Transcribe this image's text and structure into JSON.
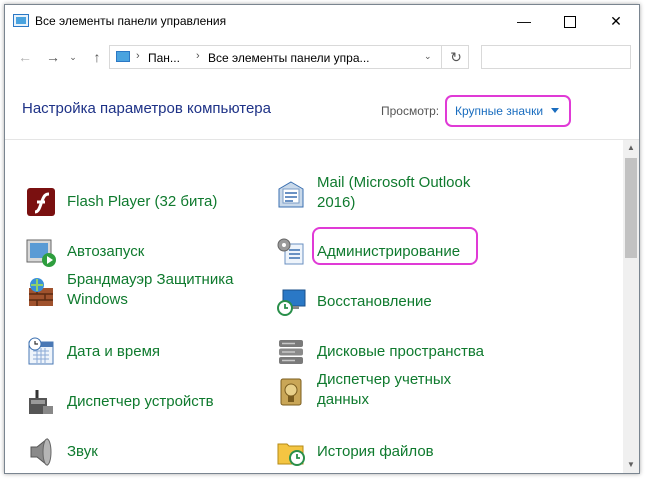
{
  "window": {
    "title": "Все элементы панели управления",
    "icons": [
      "control-panel-icon",
      "minimize-icon",
      "maximize-icon",
      "close-icon"
    ]
  },
  "address": {
    "back": "←",
    "forward": "→",
    "recent": "⌄",
    "up": "↑",
    "sep": "›",
    "crumbs": [
      "Пан...",
      "Все элементы панели упра..."
    ],
    "dropdown": "⌄",
    "refresh": "↻",
    "search_placeholder": ""
  },
  "header": {
    "title": "Настройка параметров компьютера",
    "view_label": "Просмотр:",
    "view_value": "Крупные значки"
  },
  "items": {
    "left": [
      {
        "label": "Flash Player (32 бита)",
        "icon": "flash-player-icon"
      },
      {
        "label": "Автозапуск",
        "icon": "autoplay-icon"
      },
      {
        "label": "Брандмауэр Защитника Windows",
        "icon": "firewall-icon"
      },
      {
        "label": "Дата и время",
        "icon": "calendar-clock-icon"
      },
      {
        "label": "Диспетчер устройств",
        "icon": "device-manager-icon"
      },
      {
        "label": "Звук",
        "icon": "speaker-icon"
      }
    ],
    "right": [
      {
        "label": "Mail (Microsoft Outlook 2016)",
        "icon": "mail-icon"
      },
      {
        "label": "Администрирование",
        "icon": "admin-tools-icon"
      },
      {
        "label": "Восстановление",
        "icon": "recovery-icon"
      },
      {
        "label": "Дисковые пространства",
        "icon": "storage-spaces-icon"
      },
      {
        "label": "Диспетчер учетных данных",
        "icon": "credential-manager-icon"
      },
      {
        "label": "История файлов",
        "icon": "file-history-icon"
      }
    ]
  },
  "colors": {
    "link_green": "#0f7a2e",
    "title_blue": "#1e3287",
    "highlight": "#e03ad6"
  }
}
